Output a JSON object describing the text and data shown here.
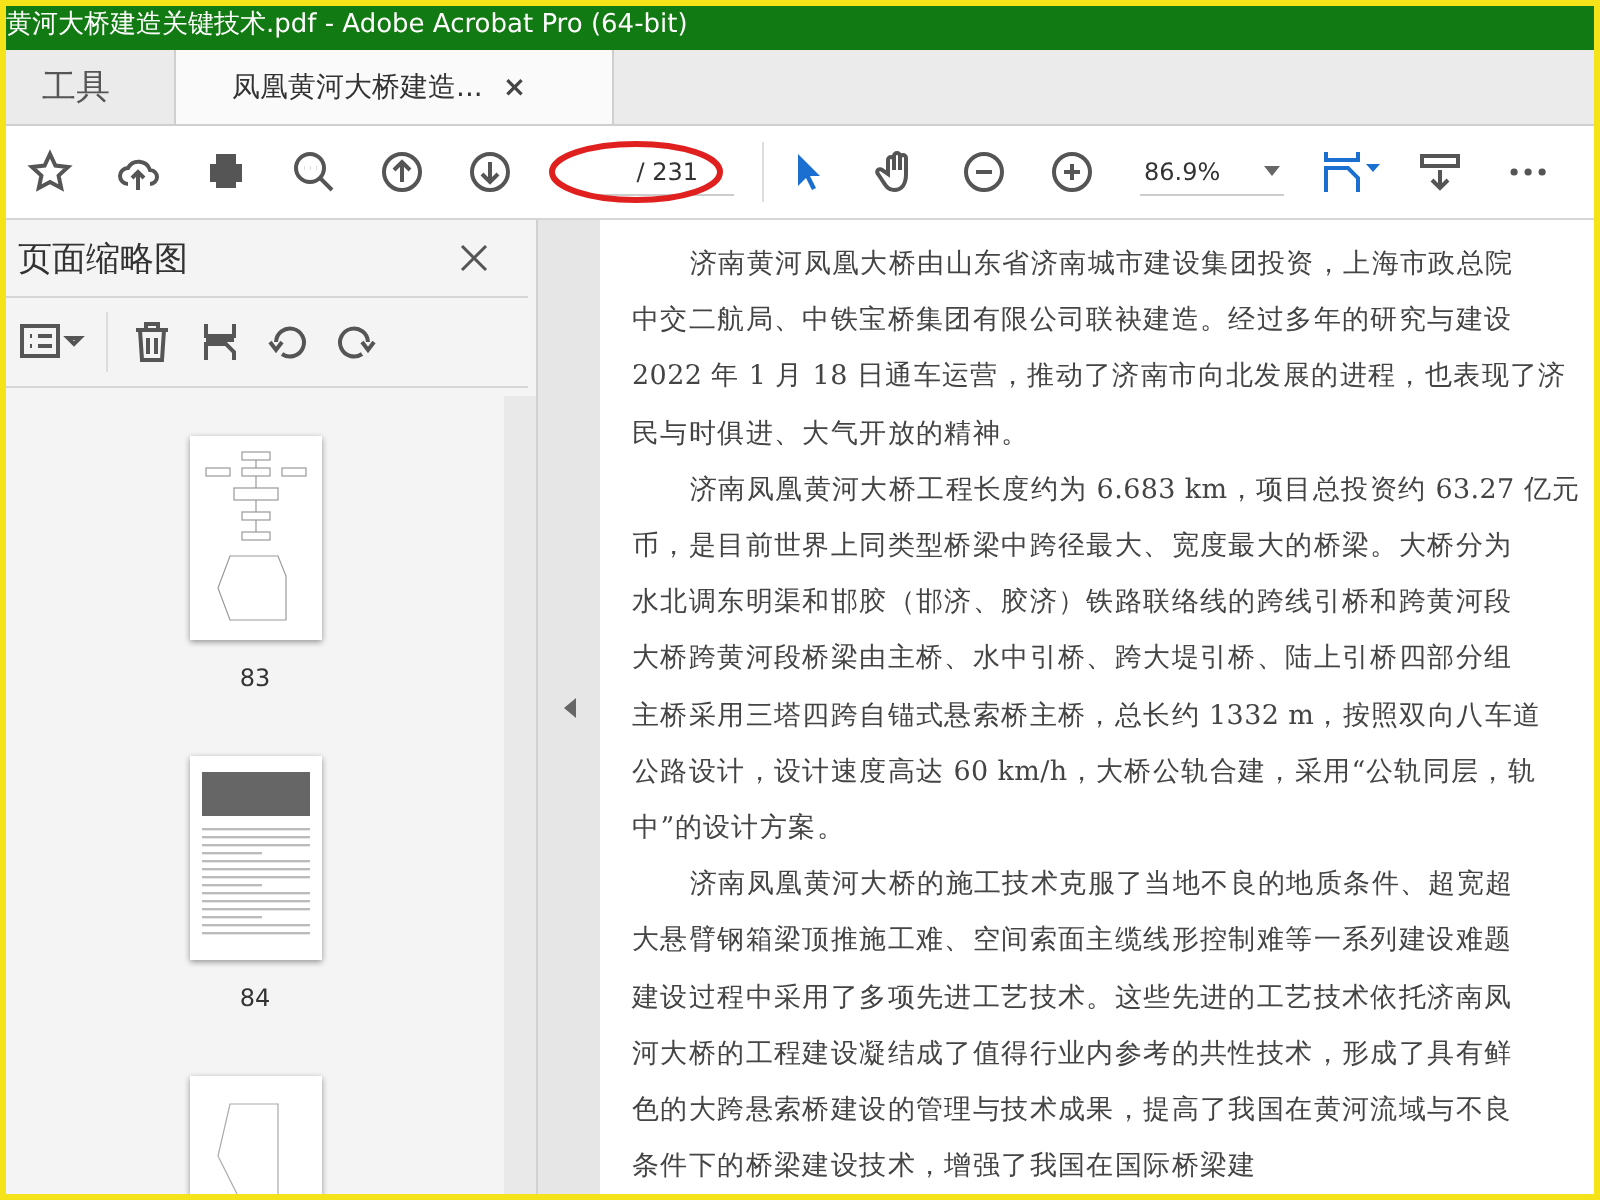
{
  "window": {
    "title": "黄河大桥建造关键技术.pdf - Adobe Acrobat Pro (64-bit)"
  },
  "tabs": [
    {
      "label": "工具",
      "selected": false
    },
    {
      "label": "凤凰黄河大桥建造...",
      "selected": true,
      "close": "×"
    }
  ],
  "toolbar": {
    "page_total": "/ 231",
    "zoom": "86.9%"
  },
  "thumbnails_panel": {
    "title": "页面缩略图",
    "pages": [
      {
        "label": "83",
        "kind": "flowchart"
      },
      {
        "label": "84",
        "kind": "photo"
      },
      {
        "kind": "plan"
      }
    ]
  },
  "document": {
    "paragraphs": [
      {
        "lines": [
          "济南黄河凤凰大桥由山东省济南城市建设集团投资，上海市政总院",
          "中交二航局、中铁宝桥集团有限公司联袂建造。经过多年的研究与建设",
          "2022 年 1 月 18 日通车运营，推动了济南市向北发展的进程，也表现了济",
          "民与时俱进、大气开放的精神。"
        ]
      },
      {
        "lines": [
          "济南凤凰黄河大桥工程长度约为 6.683 km，项目总投资约 63.27 亿元",
          "币，是目前世界上同类型桥梁中跨径最大、宽度最大的桥梁。大桥分为",
          "水北调东明渠和邯胶（邯济、胶济）铁路联络线的跨线引桥和跨黄河段",
          "大桥跨黄河段桥梁由主桥、水中引桥、跨大堤引桥、陆上引桥四部分组",
          "主桥采用三塔四跨自锚式悬索桥主桥，总长约 1332 m，按照双向八车道",
          "公路设计，设计速度高达 60 km/h，大桥公轨合建，采用“公轨同层，轨",
          "中”的设计方案。"
        ]
      },
      {
        "lines": [
          "济南凤凰黄河大桥的施工技术克服了当地不良的地质条件、超宽超",
          "大悬臂钢箱梁顶推施工难、空间索面主缆线形控制难等一系列建设难题",
          "建设过程中采用了多项先进工艺技术。这些先进的工艺技术依托济南凤",
          "河大桥的工程建设凝结成了值得行业内参考的共性技术，形成了具有鲜",
          "色的大跨悬索桥建设的管理与技术成果，提高了我国在黄河流域与不良",
          "条件下的桥梁建设技术，增强了我国在国际桥梁建"
        ]
      }
    ]
  }
}
